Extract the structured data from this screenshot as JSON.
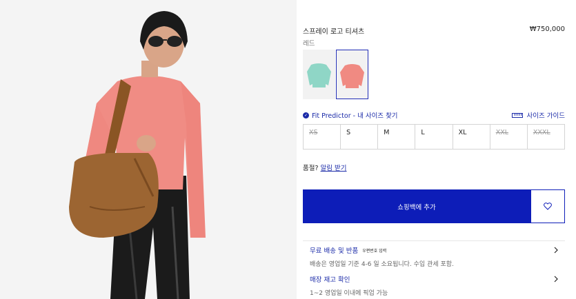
{
  "product": {
    "title": "스프레이 로고 티셔츠",
    "price": "₩750,000",
    "color_name": "레드"
  },
  "colors": {
    "teal": "#8fd6c6",
    "pink": "#f08a82",
    "accent": "#0d1db8"
  },
  "fit_predictor": {
    "label": "Fit Predictor - 내 사이즈 찾기"
  },
  "size_guide": {
    "label": "사이즈 가이드"
  },
  "sizes": [
    {
      "label": "XS",
      "available": false
    },
    {
      "label": "S",
      "available": true
    },
    {
      "label": "M",
      "available": true
    },
    {
      "label": "L",
      "available": true
    },
    {
      "label": "XL",
      "available": true
    },
    {
      "label": "XXL",
      "available": false
    },
    {
      "label": "XXXL",
      "available": false
    }
  ],
  "soldout": {
    "prefix": "품절? ",
    "link": "알림 받기"
  },
  "add_to_bag": {
    "label": "쇼핑백에 추가"
  },
  "shipping": {
    "title": "무료 배송 및 반품",
    "tag": "우편번호 입력",
    "subtitle": "배송은 영업일 기준 4-6 일 소요됩니다. 수입 관세 포함."
  },
  "store": {
    "title": "매장 재고 확인",
    "subtitle": "1~2 영업일 이내에 픽업 가능"
  }
}
